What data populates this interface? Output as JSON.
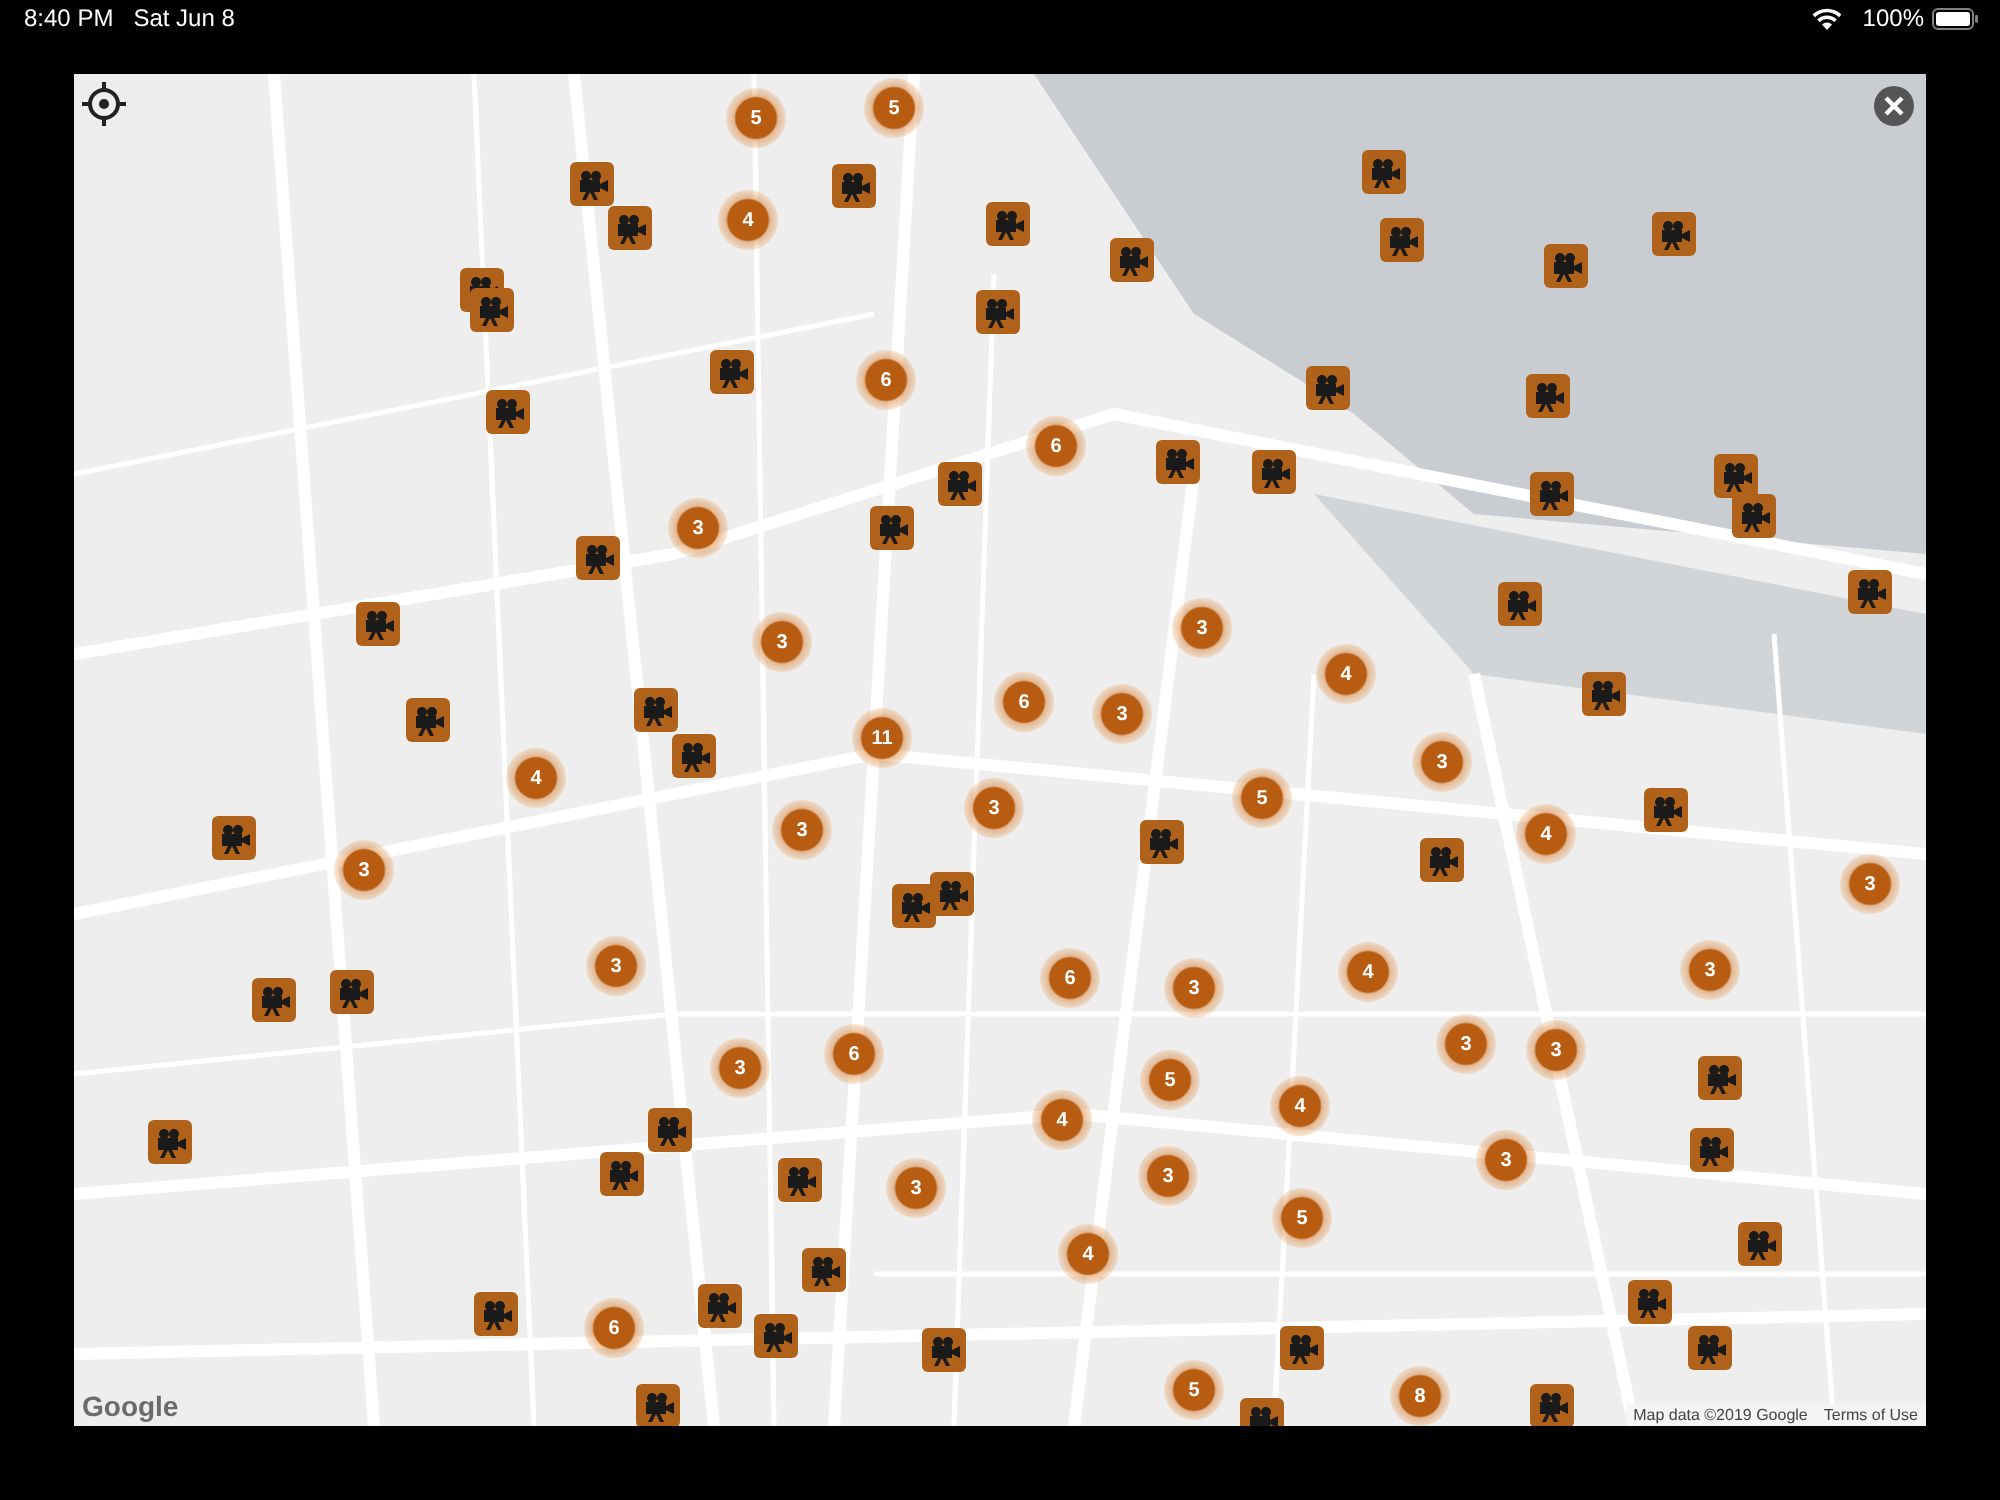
{
  "status_bar": {
    "time": "8:40 PM",
    "date": "Sat Jun 8",
    "battery": "100%"
  },
  "map": {
    "clusters": [
      {
        "count": "5"
      },
      {
        "count": "5"
      },
      {
        "count": "4"
      },
      {
        "count": "6"
      },
      {
        "count": "6"
      },
      {
        "count": "3"
      },
      {
        "count": "3"
      },
      {
        "count": "3"
      },
      {
        "count": "4"
      },
      {
        "count": "6"
      },
      {
        "count": "3"
      },
      {
        "count": "11"
      },
      {
        "count": "3"
      },
      {
        "count": "4"
      },
      {
        "count": "3"
      },
      {
        "count": "3"
      },
      {
        "count": "5"
      },
      {
        "count": "4"
      },
      {
        "count": "3"
      },
      {
        "count": "3"
      },
      {
        "count": "3"
      },
      {
        "count": "6"
      },
      {
        "count": "3"
      },
      {
        "count": "4"
      },
      {
        "count": "3"
      },
      {
        "count": "6"
      },
      {
        "count": "3"
      },
      {
        "count": "3"
      },
      {
        "count": "3"
      },
      {
        "count": "5"
      },
      {
        "count": "4"
      },
      {
        "count": "4"
      },
      {
        "count": "3"
      },
      {
        "count": "3"
      },
      {
        "count": "3"
      },
      {
        "count": "5"
      },
      {
        "count": "4"
      },
      {
        "count": "6"
      },
      {
        "count": "5"
      },
      {
        "count": "8"
      }
    ],
    "logo": "Google",
    "attribution": "Map data ©2019 Google",
    "terms": "Terms of Use"
  }
}
